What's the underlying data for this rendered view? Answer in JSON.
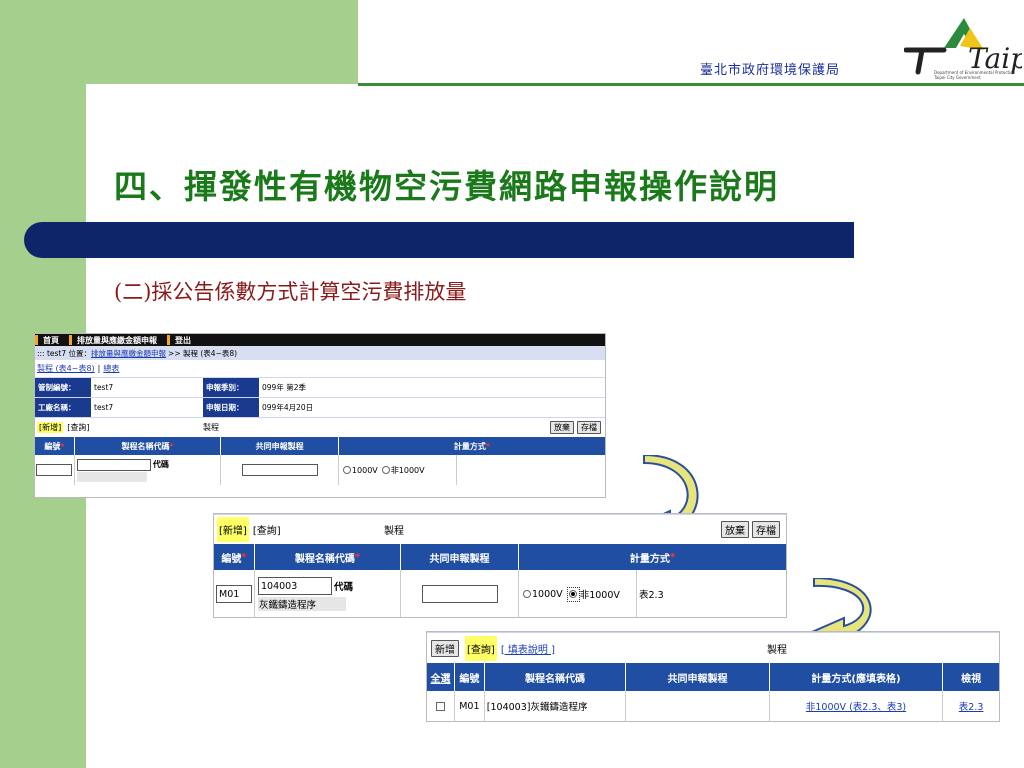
{
  "header": {
    "org_name": "臺北市政府環境保護局",
    "logo_text": "Taipei",
    "logo_sub1": "Department of Environmental Protection",
    "logo_sub2": "Taipei City Government"
  },
  "slide": {
    "title": "四、揮發性有機物空污費網路申報操作說明",
    "subtitle": "(二)採公告係數方式計算空污費排放量"
  },
  "shot1": {
    "menu": [
      "首頁",
      "排放量與應繳金額申報",
      "登出"
    ],
    "loc_prefix": "::: test7  位置：",
    "loc_link": "排放量與應繳金額申報",
    "loc_suffix": ">> 製程 (表4~表8)",
    "tab_link1": "製程 (表4~表8)",
    "tab_sep": "|",
    "tab_link2": "總表",
    "info": {
      "ctrl_label": "管制編號：",
      "ctrl_value": "test7",
      "season_label": "申報季別：",
      "season_value": "099年  第2季",
      "factory_label": "工廠名稱：",
      "factory_value": "test7",
      "date_label": "申報日期：",
      "date_value": "099年4月20日"
    },
    "act_add": "[新增]",
    "act_query": "[查詢]",
    "act_title": "製程",
    "btn_discard": "放棄",
    "btn_save": "存檔",
    "col_no": "編號",
    "col_code": "製程名稱代碼",
    "col_shared": "共同申報製程",
    "col_method": "計量方式",
    "req": "*",
    "code_label": "代碼",
    "opt1": "1000V",
    "opt2": "非1000V"
  },
  "shot2": {
    "act_add": "[新增]",
    "act_query": "[查詢]",
    "act_title": "製程",
    "btn_discard": "放棄",
    "btn_save": "存檔",
    "col_no": "編號",
    "col_code": "製程名稱代碼",
    "col_shared": "共同申報製程",
    "col_method": "計量方式",
    "req": "*",
    "row_no": "M01",
    "row_code": "104003",
    "code_label": "代碼",
    "row_name": "灰鐵鑄造程序",
    "opt1": "1000V",
    "opt2": "非1000V",
    "table_ref": "表2.3"
  },
  "shot3": {
    "btn_add": "新增",
    "act_query": "[查詢]",
    "act_help": "[ 填表說明 ]",
    "act_title": "製程",
    "col_all": "全選",
    "col_no": "編號",
    "col_code": "製程名稱代碼",
    "col_shared": "共同申報製程",
    "col_method": "計量方式(應填表格)",
    "col_view": "檢視",
    "row_no": "M01",
    "row_code": "[104003]灰鐵鑄造程序",
    "row_method": "非1000V (表2.3、表3)",
    "row_view": "表2.3"
  },
  "colors": {
    "green_bg": "#a5cf8c",
    "title_green": "#1a7a1a",
    "navy": "#0f2569",
    "subtitle_red": "#8b1a1a",
    "table_header": "#1f4ea3",
    "arrow_yellow": "#e6e47a"
  }
}
